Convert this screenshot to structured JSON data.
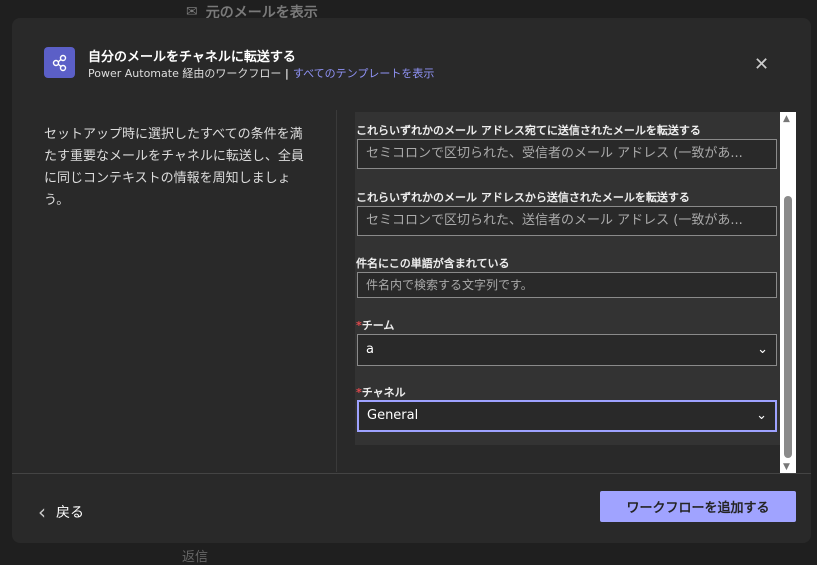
{
  "background": {
    "top_text": "元のメールを表示",
    "bottom_text": "返信"
  },
  "header": {
    "title": "自分のメールをチャネルに転送する",
    "subtitle": "Power Automate 経由のワークフロー",
    "separator": "|",
    "templates_link": "すべてのテンプレートを表示"
  },
  "description": "セットアップ時に選択したすべての条件を満たす重要なメールをチャネルに転送し、全員に同じコンテキストの情報を周知しましょう。",
  "form": {
    "to_label": "これらいずれかのメール アドレス宛てに送信されたメールを転送する",
    "to_placeholder": "セミコロンで区切られた、受信者のメール アドレス (一致があ...",
    "from_label": "これらいずれかのメール アドレスから送信されたメールを転送する",
    "from_placeholder": "セミコロンで区切られた、送信者のメール アドレス (一致があ...",
    "subject_label": "件名にこの単語が含まれている",
    "subject_placeholder": "件名内で検索する文字列です。",
    "team_label": "チーム",
    "team_value": "a",
    "channel_label": "チャネル",
    "channel_value": "General",
    "required_mark": "*"
  },
  "footer": {
    "back_label": "戻る",
    "add_label": "ワークフローを追加する"
  },
  "colors": {
    "accent": "#a0a3ff",
    "icon_bg": "#5b5fc7",
    "link": "#8f92f5"
  }
}
